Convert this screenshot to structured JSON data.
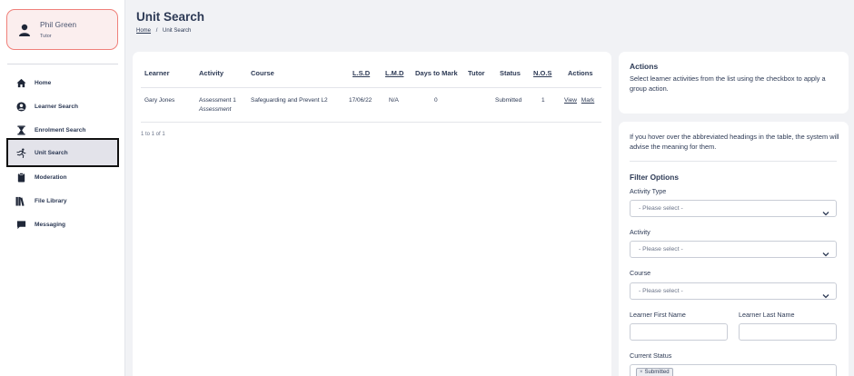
{
  "user": {
    "name": "Phil Green",
    "role": "Tutor"
  },
  "nav": [
    {
      "label": "Home",
      "icon": "home-icon"
    },
    {
      "label": "Learner Search",
      "icon": "user-circle-icon"
    },
    {
      "label": "Enrolment Search",
      "icon": "hourglass-icon"
    },
    {
      "label": "Unit Search",
      "icon": "running-person-icon",
      "active": true
    },
    {
      "label": "Moderation",
      "icon": "clipboard-icon"
    },
    {
      "label": "File Library",
      "icon": "books-icon"
    },
    {
      "label": "Messaging",
      "icon": "chat-icon"
    }
  ],
  "page": {
    "title": "Unit Search",
    "breadcrumb": {
      "home": "Home",
      "separator": "/",
      "current": "Unit Search"
    }
  },
  "table": {
    "headers": {
      "learner": "Learner",
      "activity": "Activity",
      "course": "Course",
      "lsd": "L.S.D",
      "lmd": "L.M.D",
      "days_to_mark": "Days to Mark",
      "tutor": "Tutor",
      "status": "Status",
      "nos": "N.O.S",
      "actions": "Actions"
    },
    "rows": [
      {
        "learner": "Gary Jones",
        "activity": "Assessment 1",
        "activity_type": "Assessment",
        "course": "Safeguarding and Prevent L2",
        "lsd": "17/06/22",
        "lmd": "N/A",
        "days_to_mark": "0",
        "tutor": "",
        "status": "Submitted",
        "nos": "1",
        "view_label": "View",
        "mark_label": "Mark"
      }
    ],
    "pager": "1 to 1 of 1"
  },
  "actions_panel": {
    "title": "Actions",
    "text": "Select learner activities from the list using the checkbox to apply a group action."
  },
  "filters": {
    "hint": "If you hover over the abbreviated headings in the table, the system will advise the meaning for them.",
    "title": "Filter Options",
    "activity_type_label": "Activity Type",
    "activity_type_value": "- Please select -",
    "activity_label": "Activity",
    "activity_value": "- Please select -",
    "course_label": "Course",
    "course_value": "- Please select -",
    "first_name_label": "Learner First Name",
    "first_name_value": "",
    "last_name_label": "Learner Last Name",
    "last_name_value": "",
    "status_label": "Current Status",
    "status_tag": "Submitted",
    "status_tag_remove": "×"
  },
  "colors": {
    "text": "#2d3a55",
    "background": "#f1f2f5",
    "profile_border": "#f0807a",
    "profile_bg": "#fbeeee",
    "active_nav_bg": "#e3e3ea"
  }
}
